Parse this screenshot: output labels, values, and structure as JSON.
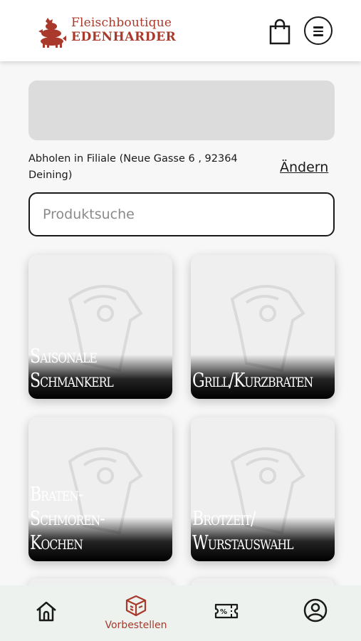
{
  "brand": {
    "line1": "Fleischboutique",
    "line2": "EDENHARDER",
    "color": "#a8392b"
  },
  "header": {
    "cart_icon": "shopping-bag-icon",
    "menu_icon": "hamburger-menu-icon"
  },
  "pickup": {
    "text": "Abholen in Filiale (Neue Gasse 6 , 92364 Deining)",
    "change_label": "Ändern"
  },
  "search": {
    "placeholder": "Produktsuche",
    "value": ""
  },
  "categories": [
    {
      "label": "Saisonale\nSchmankerl"
    },
    {
      "label": "Grill/Kurzbraten"
    },
    {
      "label": "Braten-\nSchmoren-\nKochen"
    },
    {
      "label": "Brotzeit/\nWurstauswahl"
    }
  ],
  "bottom_nav": {
    "items": [
      {
        "icon": "home-icon",
        "label": ""
      },
      {
        "icon": "preorder-box-icon",
        "label": "Vorbestellen",
        "active": true
      },
      {
        "icon": "coupon-icon",
        "label": ""
      },
      {
        "icon": "account-icon",
        "label": ""
      }
    ],
    "active_color": "#a8392b",
    "background": "#edf2ee"
  }
}
